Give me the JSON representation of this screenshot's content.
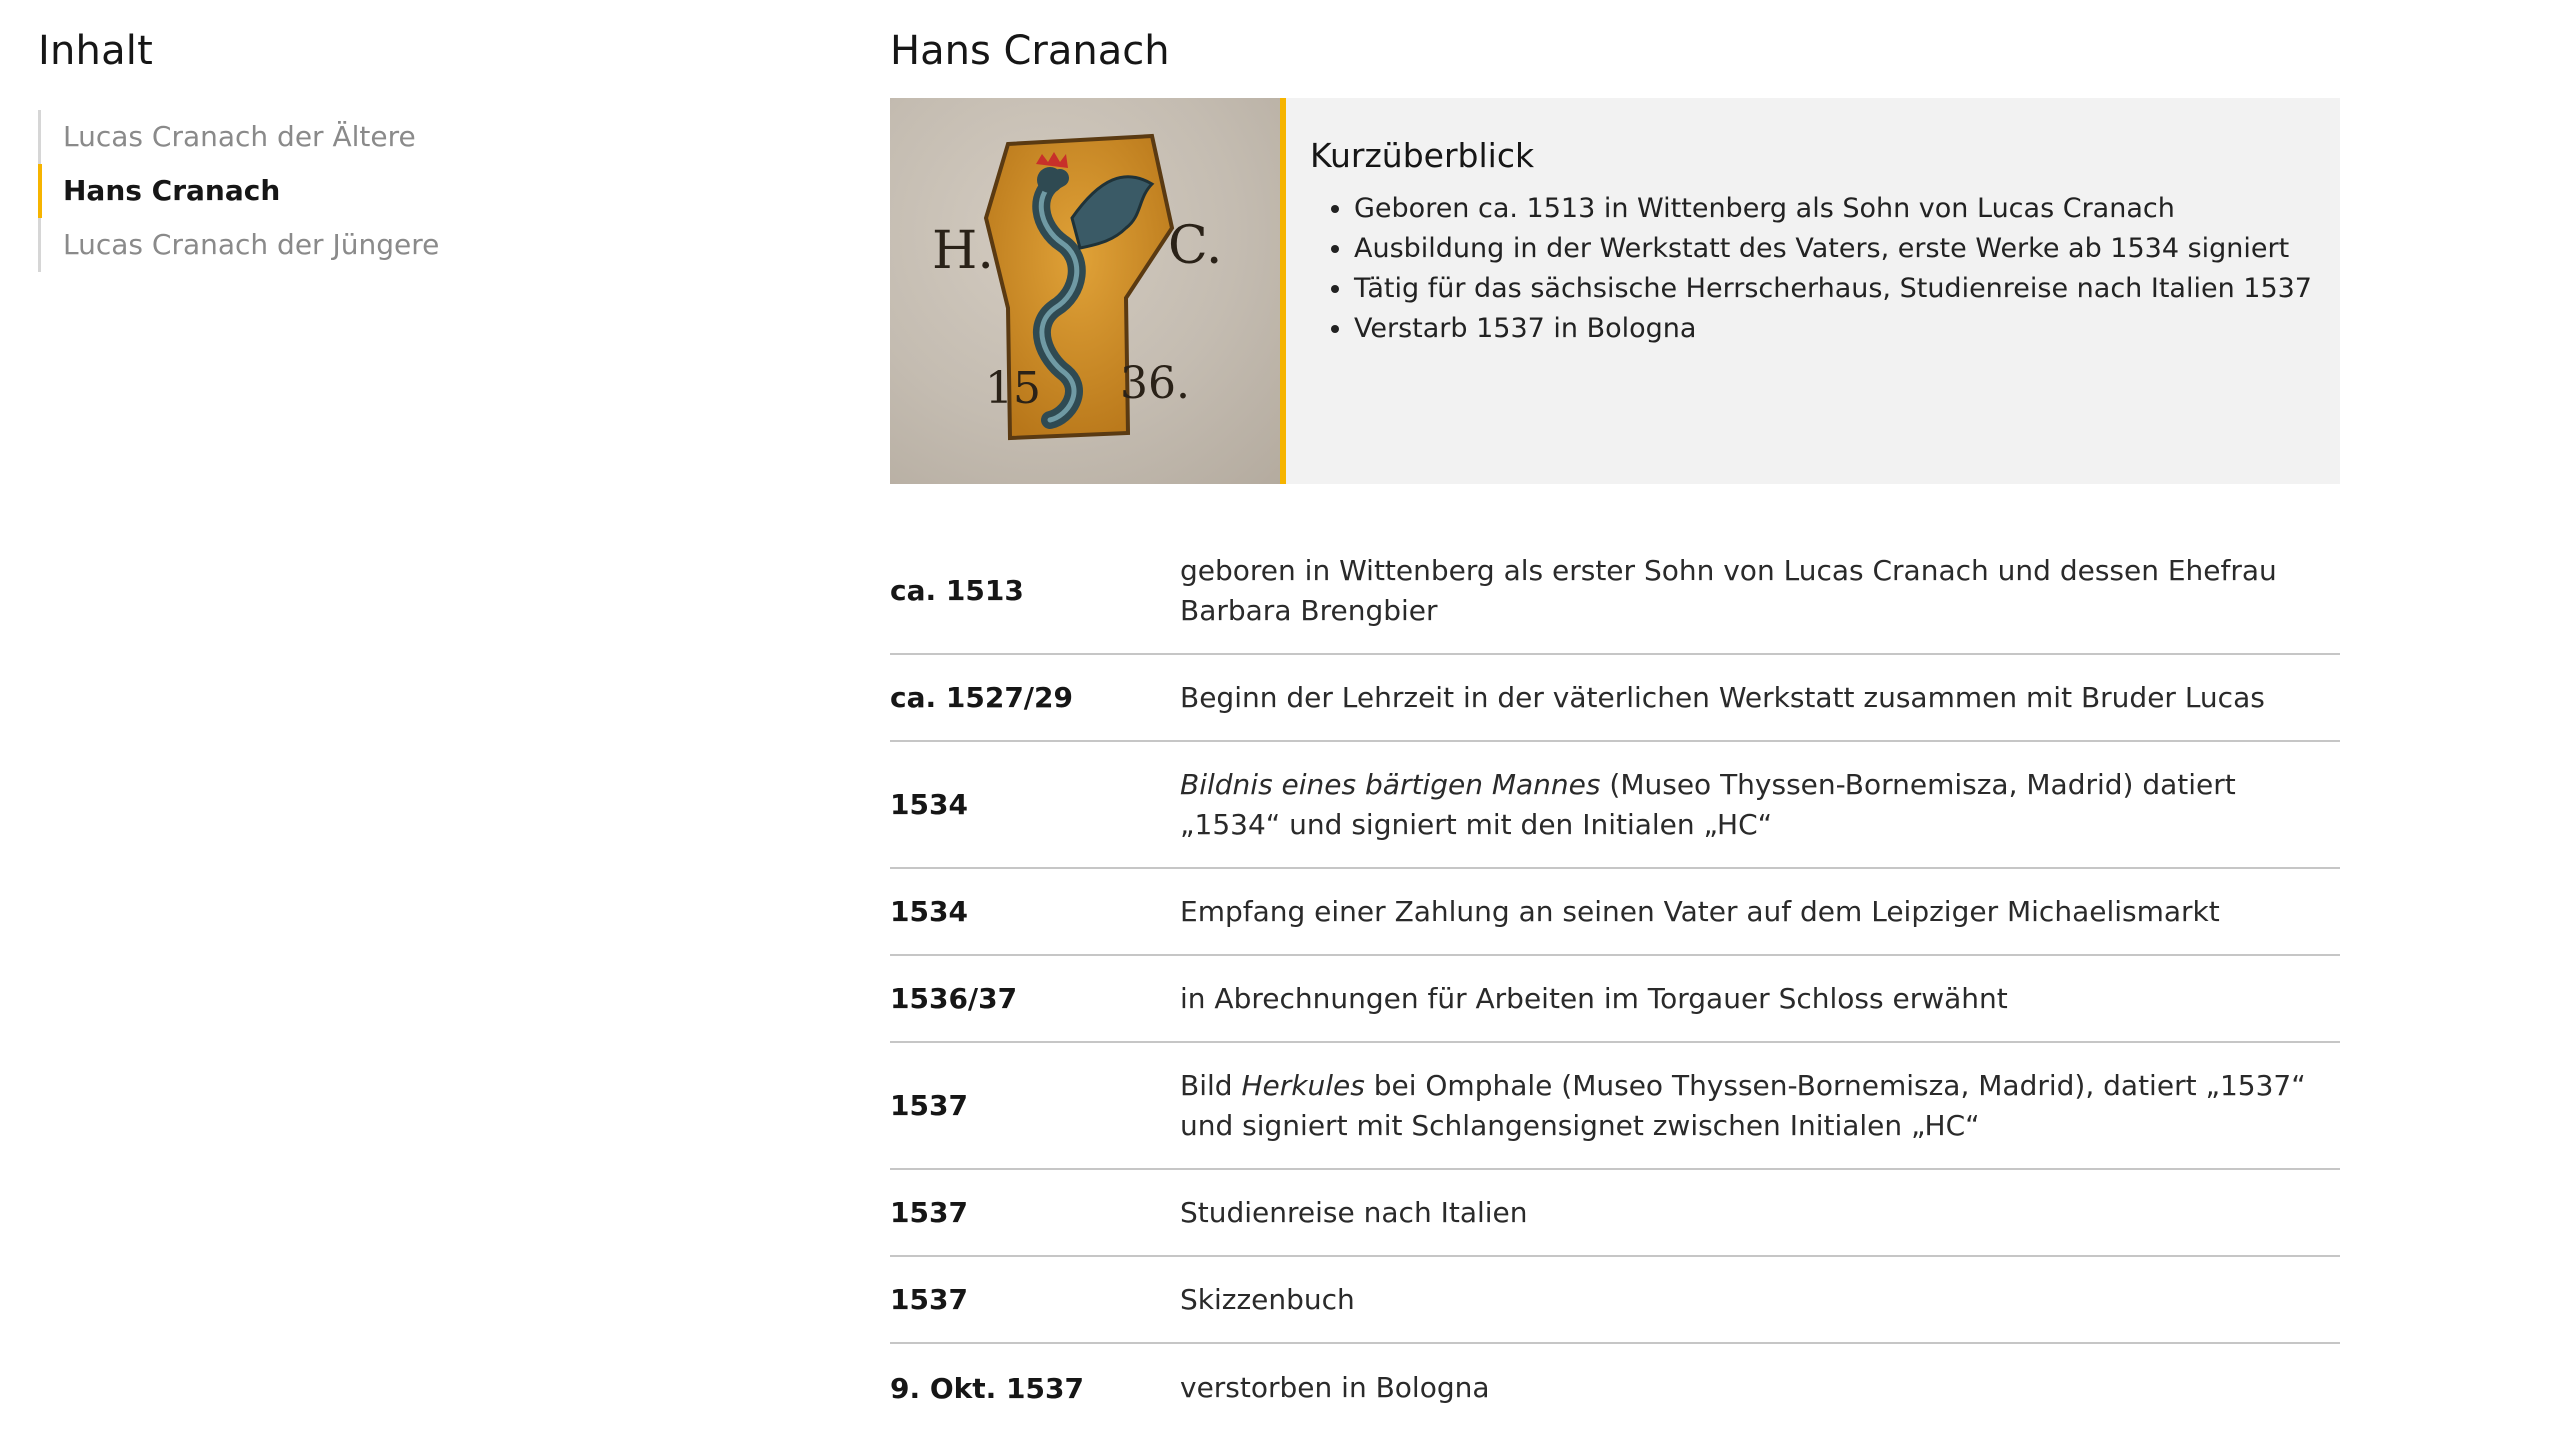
{
  "sidebar": {
    "title": "Inhalt",
    "items": [
      {
        "label": "Lucas Cranach der Ältere",
        "active": false
      },
      {
        "label": "Hans Cranach",
        "active": true
      },
      {
        "label": "Lucas Cranach der Jüngere",
        "active": false
      }
    ]
  },
  "main": {
    "title": "Hans Cranach",
    "portrait": {
      "letters_left": "H.",
      "letters_right": "C.",
      "year_left": "15",
      "year_right": "36."
    },
    "overview": {
      "heading": "Kurzüberblick",
      "bullets": [
        "Geboren ca. 1513 in Wittenberg als Sohn von Lucas Cranach",
        "Ausbildung in der Werkstatt des Vaters, erste Werke ab 1534 signiert",
        "Tätig für das sächsische Herrscherhaus, Studienreise nach Italien 1537",
        "Verstarb 1537 in Bologna"
      ]
    },
    "timeline": [
      {
        "date": "ca. 1513",
        "pre": "",
        "italic": "",
        "text": "geboren in Wittenberg als erster Sohn von Lucas Cranach und dessen Ehefrau Barbara Brengbier"
      },
      {
        "date": "ca. 1527/29",
        "pre": "",
        "italic": "",
        "text": "Beginn der Lehrzeit in der väterlichen Werkstatt zusammen mit Bruder Lucas"
      },
      {
        "date": "1534",
        "pre": "",
        "italic": "Bildnis eines bärtigen Mannes",
        "text": " (Museo Thyssen-Bornemisza, Madrid) datiert „1534“ und signiert mit den Initialen „HC“"
      },
      {
        "date": "1534",
        "pre": "",
        "italic": "",
        "text": "Empfang einer Zahlung an seinen Vater auf dem Leipziger Michaelismarkt"
      },
      {
        "date": "1536/37",
        "pre": "",
        "italic": "",
        "text": "in Abrechnungen für Arbeiten im Torgauer Schloss erwähnt"
      },
      {
        "date": "1537",
        "pre": "Bild ",
        "italic": "Herkules",
        "text": " bei Omphale (Museo Thyssen-Bornemisza, Madrid), datiert „1537“ und signiert mit Schlangensignet zwischen Initialen „HC“"
      },
      {
        "date": "1537",
        "pre": "",
        "italic": "",
        "text": "Studienreise nach Italien"
      },
      {
        "date": "1537",
        "pre": "",
        "italic": "",
        "text": "Skizzenbuch"
      },
      {
        "date": "9. Okt. 1537",
        "pre": "",
        "italic": "",
        "text": "verstorben in Bologna"
      }
    ]
  },
  "colors": {
    "accent": "#f6b400",
    "panel": "#f2f2f2",
    "divider": "#c6c6c6"
  }
}
